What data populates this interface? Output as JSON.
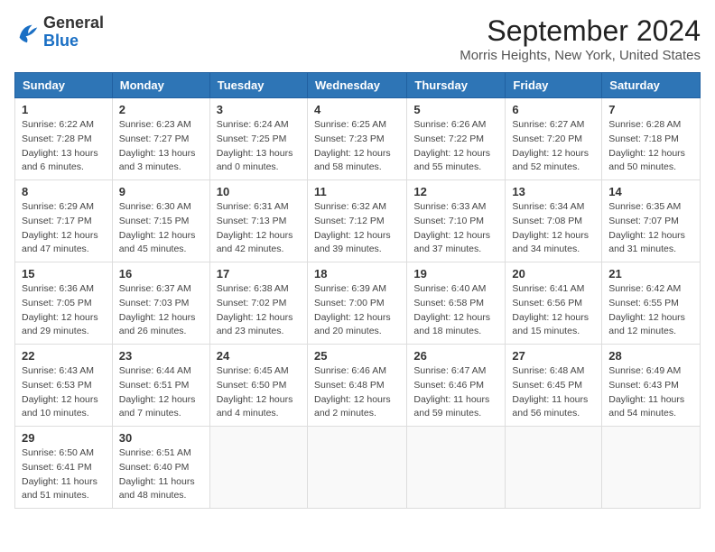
{
  "header": {
    "logo_line1": "General",
    "logo_line2": "Blue",
    "title": "September 2024",
    "subtitle": "Morris Heights, New York, United States"
  },
  "columns": [
    "Sunday",
    "Monday",
    "Tuesday",
    "Wednesday",
    "Thursday",
    "Friday",
    "Saturday"
  ],
  "weeks": [
    [
      {
        "day": "1",
        "sunrise": "6:22 AM",
        "sunset": "7:28 PM",
        "daylight": "13 hours and 6 minutes."
      },
      {
        "day": "2",
        "sunrise": "6:23 AM",
        "sunset": "7:27 PM",
        "daylight": "13 hours and 3 minutes."
      },
      {
        "day": "3",
        "sunrise": "6:24 AM",
        "sunset": "7:25 PM",
        "daylight": "13 hours and 0 minutes."
      },
      {
        "day": "4",
        "sunrise": "6:25 AM",
        "sunset": "7:23 PM",
        "daylight": "12 hours and 58 minutes."
      },
      {
        "day": "5",
        "sunrise": "6:26 AM",
        "sunset": "7:22 PM",
        "daylight": "12 hours and 55 minutes."
      },
      {
        "day": "6",
        "sunrise": "6:27 AM",
        "sunset": "7:20 PM",
        "daylight": "12 hours and 52 minutes."
      },
      {
        "day": "7",
        "sunrise": "6:28 AM",
        "sunset": "7:18 PM",
        "daylight": "12 hours and 50 minutes."
      }
    ],
    [
      {
        "day": "8",
        "sunrise": "6:29 AM",
        "sunset": "7:17 PM",
        "daylight": "12 hours and 47 minutes."
      },
      {
        "day": "9",
        "sunrise": "6:30 AM",
        "sunset": "7:15 PM",
        "daylight": "12 hours and 45 minutes."
      },
      {
        "day": "10",
        "sunrise": "6:31 AM",
        "sunset": "7:13 PM",
        "daylight": "12 hours and 42 minutes."
      },
      {
        "day": "11",
        "sunrise": "6:32 AM",
        "sunset": "7:12 PM",
        "daylight": "12 hours and 39 minutes."
      },
      {
        "day": "12",
        "sunrise": "6:33 AM",
        "sunset": "7:10 PM",
        "daylight": "12 hours and 37 minutes."
      },
      {
        "day": "13",
        "sunrise": "6:34 AM",
        "sunset": "7:08 PM",
        "daylight": "12 hours and 34 minutes."
      },
      {
        "day": "14",
        "sunrise": "6:35 AM",
        "sunset": "7:07 PM",
        "daylight": "12 hours and 31 minutes."
      }
    ],
    [
      {
        "day": "15",
        "sunrise": "6:36 AM",
        "sunset": "7:05 PM",
        "daylight": "12 hours and 29 minutes."
      },
      {
        "day": "16",
        "sunrise": "6:37 AM",
        "sunset": "7:03 PM",
        "daylight": "12 hours and 26 minutes."
      },
      {
        "day": "17",
        "sunrise": "6:38 AM",
        "sunset": "7:02 PM",
        "daylight": "12 hours and 23 minutes."
      },
      {
        "day": "18",
        "sunrise": "6:39 AM",
        "sunset": "7:00 PM",
        "daylight": "12 hours and 20 minutes."
      },
      {
        "day": "19",
        "sunrise": "6:40 AM",
        "sunset": "6:58 PM",
        "daylight": "12 hours and 18 minutes."
      },
      {
        "day": "20",
        "sunrise": "6:41 AM",
        "sunset": "6:56 PM",
        "daylight": "12 hours and 15 minutes."
      },
      {
        "day": "21",
        "sunrise": "6:42 AM",
        "sunset": "6:55 PM",
        "daylight": "12 hours and 12 minutes."
      }
    ],
    [
      {
        "day": "22",
        "sunrise": "6:43 AM",
        "sunset": "6:53 PM",
        "daylight": "12 hours and 10 minutes."
      },
      {
        "day": "23",
        "sunrise": "6:44 AM",
        "sunset": "6:51 PM",
        "daylight": "12 hours and 7 minutes."
      },
      {
        "day": "24",
        "sunrise": "6:45 AM",
        "sunset": "6:50 PM",
        "daylight": "12 hours and 4 minutes."
      },
      {
        "day": "25",
        "sunrise": "6:46 AM",
        "sunset": "6:48 PM",
        "daylight": "12 hours and 2 minutes."
      },
      {
        "day": "26",
        "sunrise": "6:47 AM",
        "sunset": "6:46 PM",
        "daylight": "11 hours and 59 minutes."
      },
      {
        "day": "27",
        "sunrise": "6:48 AM",
        "sunset": "6:45 PM",
        "daylight": "11 hours and 56 minutes."
      },
      {
        "day": "28",
        "sunrise": "6:49 AM",
        "sunset": "6:43 PM",
        "daylight": "11 hours and 54 minutes."
      }
    ],
    [
      {
        "day": "29",
        "sunrise": "6:50 AM",
        "sunset": "6:41 PM",
        "daylight": "11 hours and 51 minutes."
      },
      {
        "day": "30",
        "sunrise": "6:51 AM",
        "sunset": "6:40 PM",
        "daylight": "11 hours and 48 minutes."
      },
      null,
      null,
      null,
      null,
      null
    ]
  ]
}
